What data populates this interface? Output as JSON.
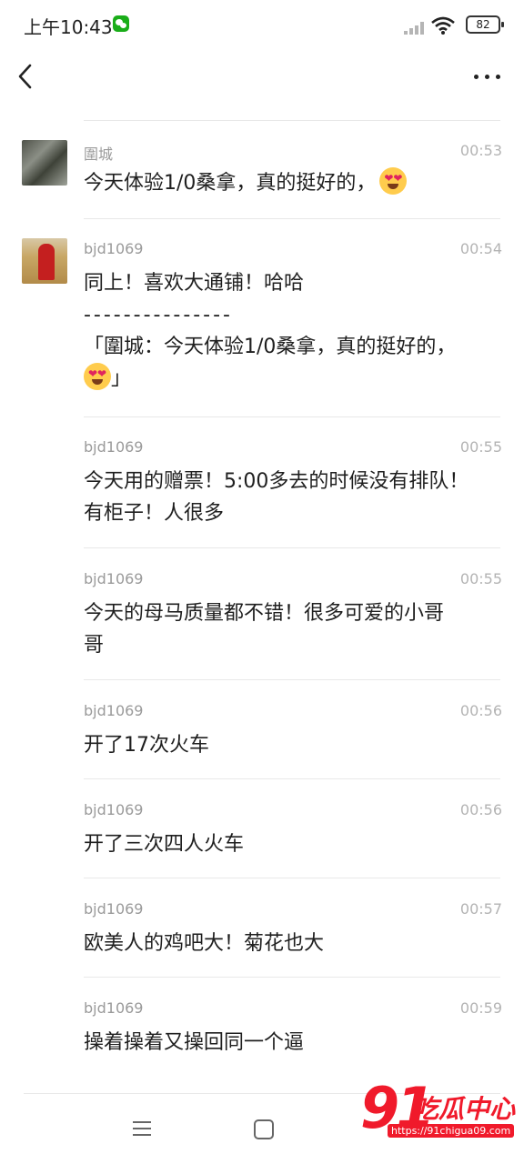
{
  "status_bar": {
    "time": "上午10:43",
    "battery": "82"
  },
  "nav": {
    "back_icon": "chevron-left-icon",
    "more_icon": "more-dots-icon"
  },
  "comments": [
    {
      "author": "圍城",
      "time": "00:53",
      "text": "今天体验1/0桑拿，真的挺好的，",
      "emoji": "heart-eyes-emoji"
    },
    {
      "author": "bjd1069",
      "time": "00:54",
      "line1": "同上！喜欢大通铺！哈哈",
      "line2": "- - - - - - - - - - - - - - -",
      "line3": "「圍城：今天体验1/0桑拿，真的挺好的，",
      "line4_suffix": "」",
      "emoji": "heart-eyes-emoji"
    },
    {
      "author": "bjd1069",
      "time": "00:55",
      "line1": "今天用的赠票！5:00多去的时候没有排队！",
      "line2": "有柜子！人很多"
    },
    {
      "author": "bjd1069",
      "time": "00:55",
      "line1": "今天的母马质量都不错！很多可爱的小哥",
      "line2": "哥"
    },
    {
      "author": "bjd1069",
      "time": "00:56",
      "text": "开了17次火车"
    },
    {
      "author": "bjd1069",
      "time": "00:56",
      "text": "开了三次四人火车"
    },
    {
      "author": "bjd1069",
      "time": "00:57",
      "text": "欧美人的鸡吧大！菊花也大"
    },
    {
      "author": "bjd1069",
      "time": "00:59",
      "text": "操着操着又操回同一个逼"
    }
  ],
  "bottom_nav": {
    "menu_icon": "menu-icon",
    "home_icon": "home-square-icon"
  },
  "watermark": {
    "number": "91",
    "name": "吃瓜中心",
    "url": "https://91chigua09.com"
  },
  "colors": {
    "text": "#1f1f1f",
    "meta": "#9a9a9a",
    "divider": "#e8e8e8",
    "watermark": "#f01a2b"
  }
}
